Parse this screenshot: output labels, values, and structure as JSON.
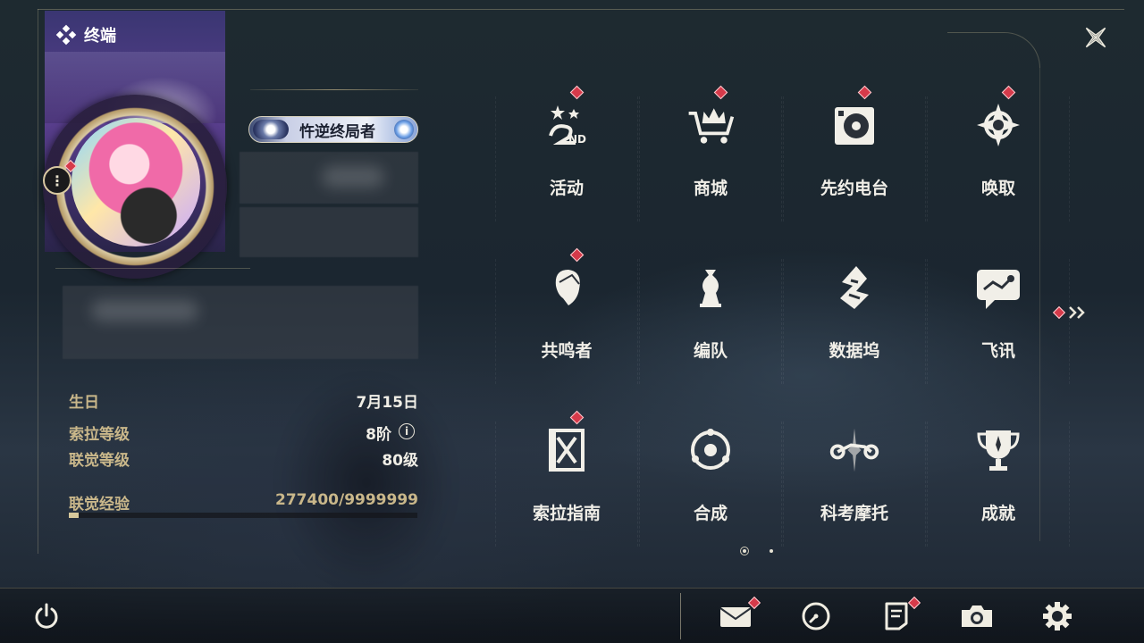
{
  "header": {
    "terminal_label": "终端"
  },
  "profile": {
    "title_plate": "忤逆终局者"
  },
  "stats": {
    "birthday_label": "生日",
    "birthday_value": "7月15日",
    "sola_level_label": "索拉等级",
    "sola_level_value": "8阶",
    "union_level_label": "联觉等级",
    "union_level_value": "80级",
    "union_exp_label": "联觉经验",
    "union_exp_value": "277400/9999999",
    "union_exp_fraction": 0.0277
  },
  "menu": {
    "items": [
      {
        "label": "活动",
        "icon": "event-2nd-anniversary-icon",
        "badge": true
      },
      {
        "label": "商城",
        "icon": "shop-crown-cart-icon",
        "badge": true
      },
      {
        "label": "先约电台",
        "icon": "radio-turntable-icon",
        "badge": true
      },
      {
        "label": "唤取",
        "icon": "convene-compass-icon",
        "badge": true
      },
      {
        "label": "共鸣者",
        "icon": "resonator-portrait-icon",
        "badge": true
      },
      {
        "label": "编队",
        "icon": "team-chess-icon",
        "badge": false
      },
      {
        "label": "数据坞",
        "icon": "data-bank-icon",
        "badge": false
      },
      {
        "label": "飞讯",
        "icon": "message-chat-icon",
        "badge": false
      },
      {
        "label": "索拉指南",
        "icon": "guidebook-icon",
        "badge": true
      },
      {
        "label": "合成",
        "icon": "synthesis-icon",
        "badge": false
      },
      {
        "label": "科考摩托",
        "icon": "motorcycle-icon",
        "badge": false
      },
      {
        "label": "成就",
        "icon": "trophy-icon",
        "badge": false
      }
    ],
    "page_indicator": {
      "current": 1,
      "total": 2
    }
  },
  "colors": {
    "accent_gold": "#c9b78a",
    "badge_red": "#d63a4a",
    "text_light": "#f1efe8"
  }
}
